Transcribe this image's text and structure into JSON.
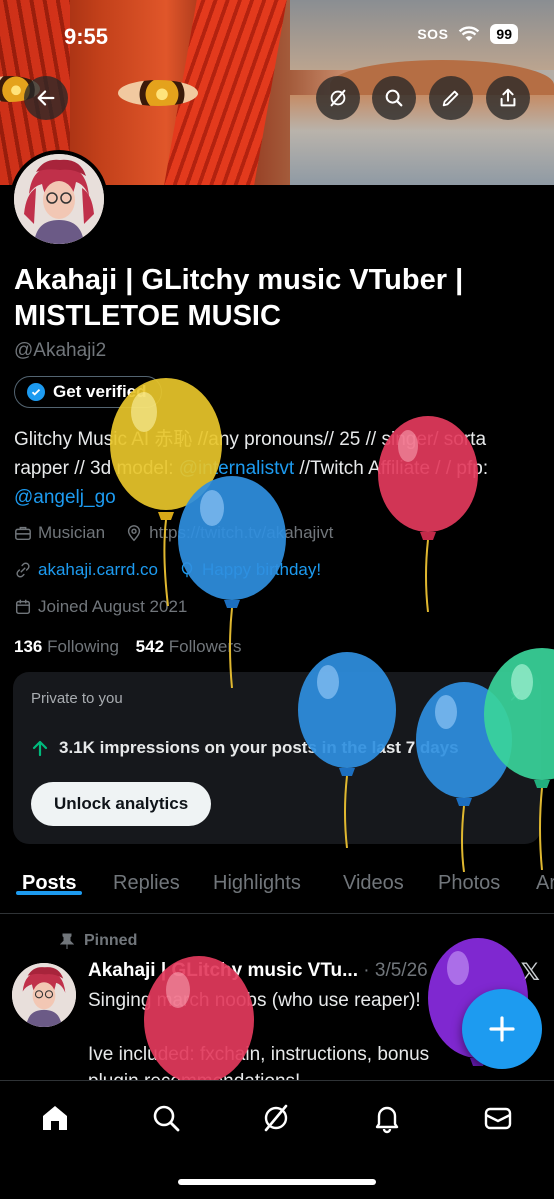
{
  "status_bar": {
    "time": "9:55",
    "sos": "SOS",
    "battery": "99"
  },
  "profile": {
    "name": "Akahaji | GLitchy music VTuber | MISTLETOE MUSIC",
    "handle": "@Akahaji2",
    "verify_label": "Get verified",
    "bio": {
      "text1": "Glitchy Music AI 赤恥 //any pronouns// 25 // singer/ sorta rapper // 3d model: ",
      "mention": "@internalistvt",
      "text2": " //Twitch Affiliate / / pfp: ",
      "mention2": "@angelj_go"
    },
    "category": "Musician",
    "location": "https://twitch.tv/akahajivt",
    "website": "akahaji.carrd.co",
    "birthday": "Happy birthday!",
    "joined": "Joined August 2021",
    "following_count": "136",
    "following_label": "Following",
    "followers_count": "542",
    "followers_label": "Followers"
  },
  "analytics_card": {
    "label": "Private to you",
    "close": "×",
    "stat": "3.1K impressions on your posts in the last 7 days",
    "button": "Unlock analytics"
  },
  "tabs": [
    "Posts",
    "Replies",
    "Highlights",
    "Videos",
    "Photos",
    "Ar"
  ],
  "pinned_post": {
    "pinned_label": "Pinned",
    "author": "Akahaji | GLitchy music VTu...",
    "date": "· 3/5/26",
    "line1": "Singing march noobs (who use reaper)!",
    "line2": "Ive included: fxchain, instructions, bonus",
    "line3": "plugin recommendations!"
  },
  "icons": {
    "back": "back-arrow-icon",
    "grok": "grok-icon",
    "search": "search-icon",
    "edit": "pencil-icon",
    "share": "share-icon"
  },
  "colors": {
    "accent": "#1d9bf0",
    "background": "#000000",
    "card": "#16181c",
    "green": "#00ba7c"
  }
}
